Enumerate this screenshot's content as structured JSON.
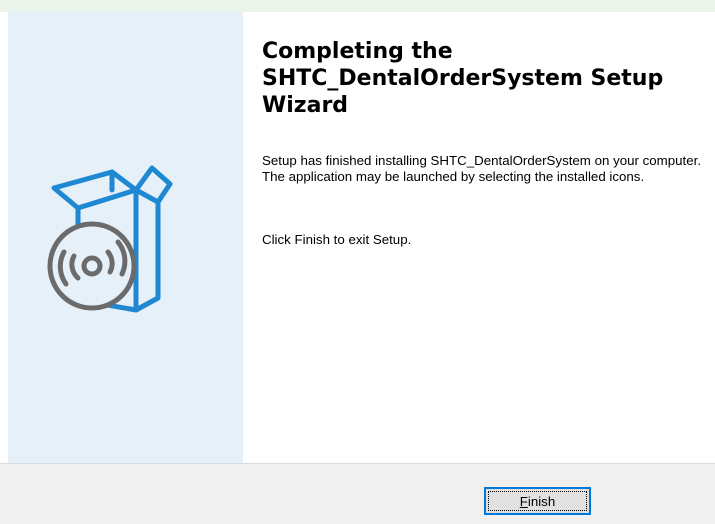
{
  "wizard": {
    "title": "Completing the SHTC_DentalOrderSystem Setup Wizard",
    "message": "Setup has finished installing SHTC_DentalOrderSystem on your computer. The application may be launched by selecting the installed icons.",
    "exit_hint": "Click Finish to exit Setup.",
    "graphic_icon": "software-box-with-disc-icon"
  },
  "footer": {
    "finish_button": {
      "mnemonic": "F",
      "rest": "inish"
    }
  },
  "colors": {
    "left_panel": "#e6f0f9",
    "box_stroke": "#1e88d2",
    "disc_stroke": "#6b6b6b",
    "button_focus_border": "#0078d7"
  }
}
